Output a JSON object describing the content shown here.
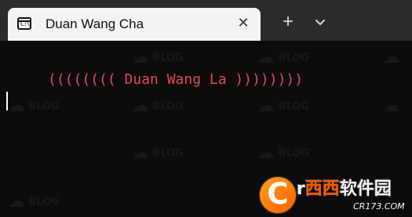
{
  "window": {
    "tab_title": "Duan Wang Cha",
    "tab_icon": "terminal-icon",
    "tab_icon_text": "C:\\",
    "close_icon": "close-icon",
    "new_tab_label": "+",
    "dropdown_icon": "chevron-down-icon"
  },
  "terminal": {
    "output": "(((((((( Duan Wang La ))))))))",
    "output_color": "#e74856",
    "background": "#0c0c0c"
  },
  "watermark": {
    "text": "BLOG"
  },
  "logo": {
    "letter": "C",
    "main_prefix": "r",
    "main_accent": "西西",
    "main_suffix": "软件园",
    "sub": "CR173.COM"
  }
}
